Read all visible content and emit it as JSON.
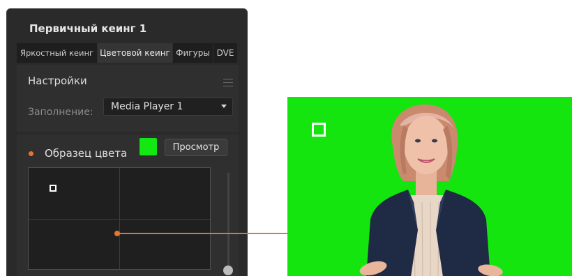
{
  "panel": {
    "title": "Первичный кеинг 1",
    "tabs": [
      {
        "label": "Яркостный кеинг",
        "active": false
      },
      {
        "label": "Цветовой кеинг",
        "active": true
      },
      {
        "label": "Фигуры",
        "active": false
      },
      {
        "label": "DVE",
        "active": false
      }
    ],
    "settings": {
      "title": "Настройки",
      "fill_label": "Заполнение:",
      "fill_value": "Media Player 1"
    },
    "color_sample": {
      "label": "Образец цвета",
      "swatch_color": "#13e813",
      "preview_button": "Просмотр"
    }
  },
  "colors": {
    "accent": "#e8742f",
    "panel_bg": "#2a2a2a",
    "green_screen": "#15e50f"
  }
}
